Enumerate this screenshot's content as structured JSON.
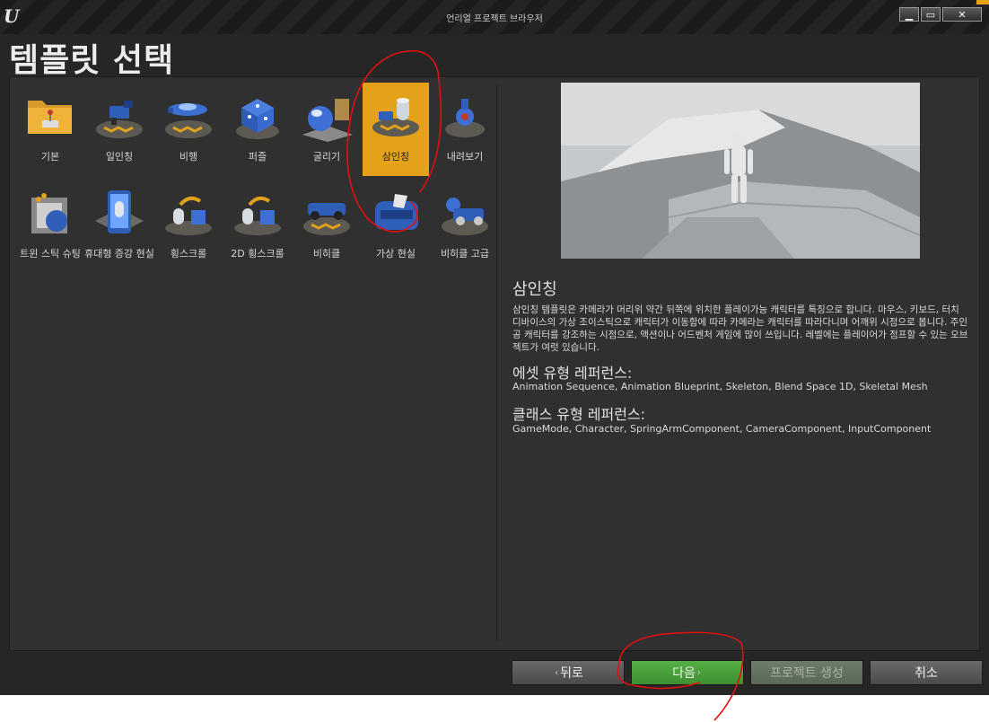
{
  "window": {
    "title": "언리얼 프로젝트 브라우저",
    "minimize": "▁",
    "maximize": "▭",
    "close": "✕"
  },
  "page_title": "템플릿 선택",
  "templates": [
    {
      "label": "기본",
      "icon": "folder-joystick-icon",
      "selected": false
    },
    {
      "label": "일인칭",
      "icon": "first-person-gun-icon",
      "selected": false
    },
    {
      "label": "비행",
      "icon": "flying-ship-icon",
      "selected": false
    },
    {
      "label": "퍼즐",
      "icon": "puzzle-cube-icon",
      "selected": false
    },
    {
      "label": "굴리기",
      "icon": "rolling-ball-icon",
      "selected": false
    },
    {
      "label": "삼인칭",
      "icon": "third-person-character-icon",
      "selected": true
    },
    {
      "label": "내려보기",
      "icon": "top-down-icon",
      "selected": false
    },
    {
      "label": "트윈 스틱 슈팅",
      "icon": "twin-stick-shooter-icon",
      "selected": false
    },
    {
      "label": "휴대형 증강 현실",
      "icon": "handheld-ar-icon",
      "selected": false
    },
    {
      "label": "횡스크롤",
      "icon": "side-scroller-icon",
      "selected": false
    },
    {
      "label": "2D 횡스크롤",
      "icon": "side-scroller-2d-icon",
      "selected": false
    },
    {
      "label": "비히클",
      "icon": "vehicle-icon",
      "selected": false
    },
    {
      "label": "가상 현실",
      "icon": "vr-headset-icon",
      "selected": false
    },
    {
      "label": "비히클 고급",
      "icon": "vehicle-advanced-icon",
      "selected": false
    }
  ],
  "detail": {
    "title": "삼인칭",
    "description": "삼인칭 템플릿은 카메라가 머리위 약간 뒤쪽에 위치한 플레이가능 캐릭터를 특징으로 합니다. 마우스, 키보드, 터치 디바이스의 가상 조이스틱으로 캐릭터가 이동함에 따라 카메라는 캐릭터를 따라다니며 어깨위 시점으로 봅니다. 주인공 캐릭터를 강조하는 시점으로, 액션이나 어드벤처 게임에 많이 쓰입니다. 레벨에는 플레이어가 점프할 수 있는 오브젝트가 여럿 있습니다.",
    "asset_ref_heading": "에셋 유형 레퍼런스:",
    "asset_ref_list": "Animation Sequence, Animation Blueprint, Skeleton, Blend Space 1D, Skeletal Mesh",
    "class_ref_heading": "클래스 유형 레퍼런스:",
    "class_ref_list": "GameMode, Character, SpringArmComponent, CameraComponent, InputComponent"
  },
  "buttons": {
    "back": "뒤로",
    "next": "다음",
    "create": "프로젝트 생성",
    "cancel": "취소"
  },
  "colors": {
    "selected": "#e4a21a",
    "next_button": "#4ba33c",
    "annotation": "#e01010"
  }
}
